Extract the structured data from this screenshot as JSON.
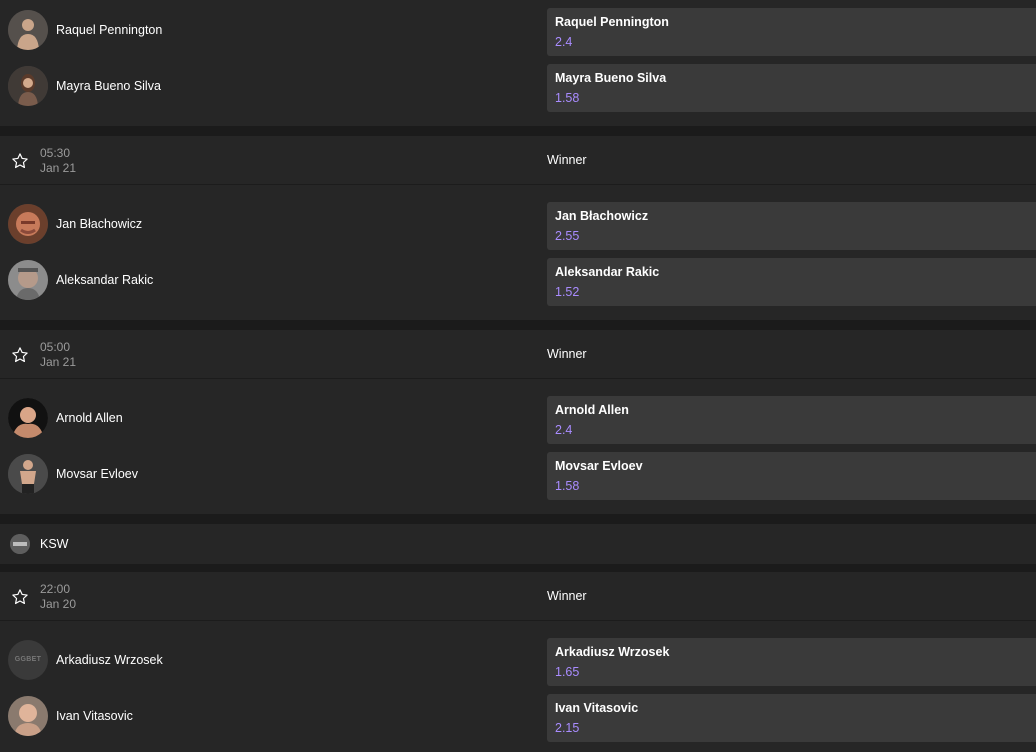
{
  "sections": [
    {
      "fighters": [
        {
          "name": "Raquel Pennington",
          "odd": "2.4"
        },
        {
          "name": "Mayra Bueno Silva",
          "odd": "1.58"
        }
      ]
    },
    {
      "time": "05:30",
      "date": "Jan 21",
      "market": "Winner",
      "fighters": [
        {
          "name": "Jan Błachowicz",
          "odd": "2.55"
        },
        {
          "name": "Aleksandar Rakic",
          "odd": "1.52"
        }
      ]
    },
    {
      "time": "05:00",
      "date": "Jan 21",
      "market": "Winner",
      "fighters": [
        {
          "name": "Arnold Allen",
          "odd": "2.4"
        },
        {
          "name": "Movsar Evloev",
          "odd": "1.58"
        }
      ]
    },
    {
      "league": "KSW",
      "time": "22:00",
      "date": "Jan 20",
      "market": "Winner",
      "fighters": [
        {
          "name": "Arkadiusz Wrzosek",
          "odd": "1.65",
          "avatar_placeholder": "GGBET"
        },
        {
          "name": "Ivan Vitasovic",
          "odd": "2.15"
        }
      ]
    }
  ],
  "icons": {
    "favorite": "star-outline-icon",
    "league": "ksw-logo-icon"
  },
  "colors": {
    "background": "#1b1b1b",
    "panel": "#262626",
    "odd_button": "#3a3a3a",
    "odd_value": "#a98cff",
    "muted_text": "#9b9b9b"
  }
}
